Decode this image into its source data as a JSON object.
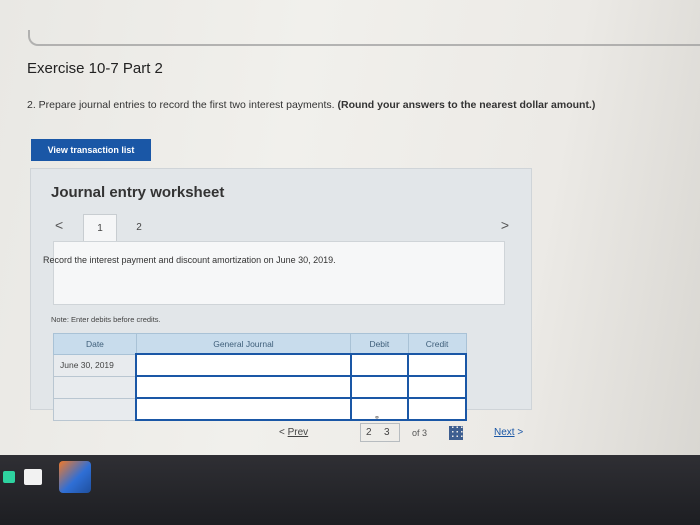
{
  "exercise": {
    "title": "Exercise 10-7 Part 2",
    "question_plain": "2. Prepare journal entries to record the first two interest payments. ",
    "question_bold": "(Round your answers to the nearest dollar amount.)",
    "view_button": "View transaction list"
  },
  "worksheet": {
    "title": "Journal entry worksheet",
    "tabs": [
      "1",
      "2"
    ],
    "prev_arrow": "<",
    "next_arrow": ">",
    "instruction": "Record the interest payment and discount amortization on June 30, 2019.",
    "note": "Note: Enter debits before credits.",
    "table": {
      "headers": [
        "Date",
        "General Journal",
        "Debit",
        "Credit"
      ],
      "rows": [
        {
          "date": "June 30, 2019"
        },
        {
          "date": ""
        },
        {
          "date": ""
        }
      ]
    }
  },
  "nav": {
    "prev_label": "Prev",
    "page_a": "2",
    "page_b": "3",
    "of_total": "of 3",
    "next_label": "Next"
  },
  "colors": {
    "primary": "#1a57a6",
    "table_header": "#c8dcec"
  }
}
